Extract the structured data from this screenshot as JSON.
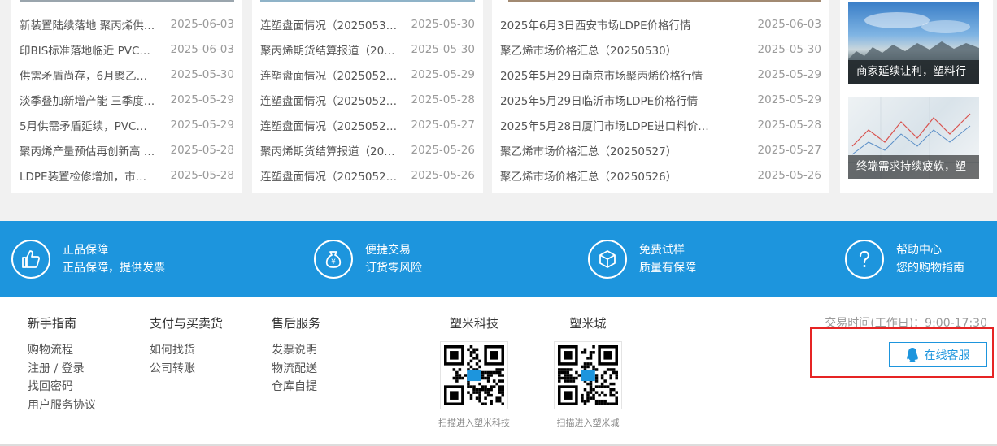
{
  "news_columns": [
    {
      "items": [
        {
          "title": "新装置陆续落地 聚丙烯供…",
          "date": "2025-06-03"
        },
        {
          "title": "印BIS标准落地临近 PVC…",
          "date": "2025-06-03"
        },
        {
          "title": "供需矛盾尚存，6月聚乙…",
          "date": "2025-05-30"
        },
        {
          "title": "淡季叠加新增产能 三季度…",
          "date": "2025-05-29"
        },
        {
          "title": "5月供需矛盾延续，PVC…",
          "date": "2025-05-29"
        },
        {
          "title": "聚丙烯产量预估再创新高 …",
          "date": "2025-05-28"
        },
        {
          "title": "LDPE装置检修增加，市…",
          "date": "2025-05-28"
        }
      ]
    },
    {
      "items": [
        {
          "title": "连塑盘面情况（2025053…",
          "date": "2025-05-30"
        },
        {
          "title": "聚丙烯期货结算报道（20…",
          "date": "2025-05-30"
        },
        {
          "title": "连塑盘面情况（2025052…",
          "date": "2025-05-29"
        },
        {
          "title": "连塑盘面情况（2025052…",
          "date": "2025-05-28"
        },
        {
          "title": "连塑盘面情况（2025052…",
          "date": "2025-05-27"
        },
        {
          "title": "聚丙烯期货结算报道（20…",
          "date": "2025-05-26"
        },
        {
          "title": "连塑盘面情况（2025052…",
          "date": "2025-05-26"
        }
      ]
    },
    {
      "items": [
        {
          "title": "2025年6月3日西安市场LDPE价格行情",
          "date": "2025-06-03"
        },
        {
          "title": "聚乙烯市场价格汇总（20250530）",
          "date": "2025-05-30"
        },
        {
          "title": "2025年5月29日南京市场聚丙烯价格行情",
          "date": "2025-05-29"
        },
        {
          "title": "2025年5月29日临沂市场LDPE价格行情",
          "date": "2025-05-29"
        },
        {
          "title": "2025年5月28日厦门市场LDPE进口料价…",
          "date": "2025-05-28"
        },
        {
          "title": "聚乙烯市场价格汇总（20250527）",
          "date": "2025-05-27"
        },
        {
          "title": "聚乙烯市场价格汇总（20250526）",
          "date": "2025-05-26"
        }
      ]
    }
  ],
  "side_thumbs": [
    {
      "caption": "商家延续让利，塑料行"
    },
    {
      "caption": "终端需求持续疲软，塑"
    }
  ],
  "services": [
    {
      "icon": "thumbs-up-icon",
      "title": "正品保障",
      "subtitle": "正品保障，提供发票"
    },
    {
      "icon": "yuan-bag-icon",
      "title": "便捷交易",
      "subtitle": "订货零风险"
    },
    {
      "icon": "box-icon",
      "title": "免费试样",
      "subtitle": "质量有保障"
    },
    {
      "icon": "question-icon",
      "title": "帮助中心",
      "subtitle": "您的购物指南"
    }
  ],
  "footer": {
    "columns": [
      {
        "heading": "新手指南",
        "links": [
          "购物流程",
          "注册 / 登录",
          "找回密码",
          "用户服务协议"
        ]
      },
      {
        "heading": "支付与买卖货",
        "links": [
          "如何找货",
          "公司转账"
        ]
      },
      {
        "heading": "售后服务",
        "links": [
          "发票说明",
          "物流配送",
          "仓库自提"
        ]
      }
    ],
    "qr_codes": [
      {
        "heading": "塑米科技",
        "hint": "扫描进入塑米科技"
      },
      {
        "heading": "塑米城",
        "hint": "扫描进入塑米城"
      }
    ],
    "hours": "交易时间(工作日)：9:00-17:30",
    "cs_button": "在线客服"
  },
  "colors": {
    "accent": "#1d95dd",
    "highlight": "#e62424"
  }
}
